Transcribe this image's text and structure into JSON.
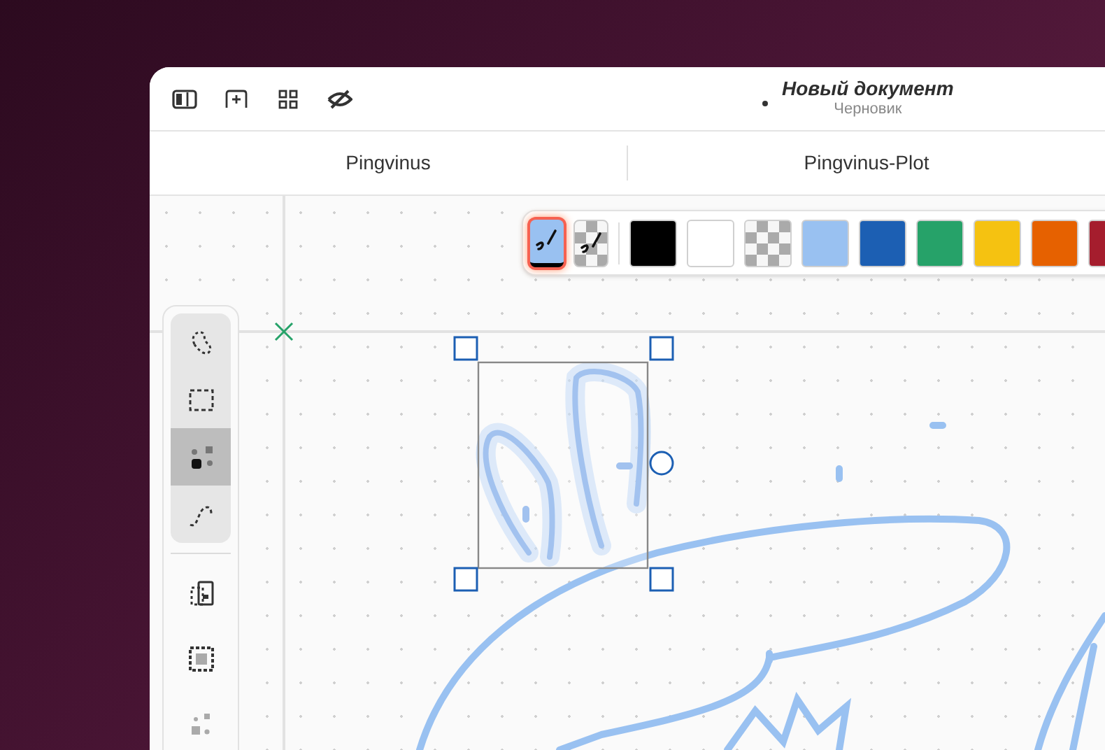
{
  "header": {
    "title": "Новый документ",
    "subtitle": "Черновик",
    "unsaved": true
  },
  "tabs": [
    {
      "label": "Pingvinus"
    },
    {
      "label": "Pingvinus-Plot"
    }
  ],
  "pen_tools": [
    {
      "kind": "pen",
      "selected": true,
      "color": "#99c1f1"
    },
    {
      "kind": "clear-pen",
      "selected": false
    }
  ],
  "swatches": [
    {
      "kind": "solid",
      "color": "#000000"
    },
    {
      "kind": "solid",
      "color": "#ffffff"
    },
    {
      "kind": "clear"
    },
    {
      "kind": "solid",
      "color": "#99c1f1"
    },
    {
      "kind": "solid",
      "color": "#1c5fb3"
    },
    {
      "kind": "solid",
      "color": "#26a269"
    },
    {
      "kind": "solid",
      "color": "#f5c211"
    },
    {
      "kind": "solid",
      "color": "#e66100"
    },
    {
      "kind": "solid",
      "color": "#a51d2d"
    }
  ],
  "select_tools": [
    {
      "kind": "lasso",
      "selected": false
    },
    {
      "kind": "rectangle",
      "selected": false
    },
    {
      "kind": "pick",
      "selected": true
    },
    {
      "kind": "path",
      "selected": false
    }
  ],
  "actions": [
    {
      "kind": "lock"
    },
    {
      "kind": "grid"
    },
    {
      "kind": "scatter"
    }
  ]
}
